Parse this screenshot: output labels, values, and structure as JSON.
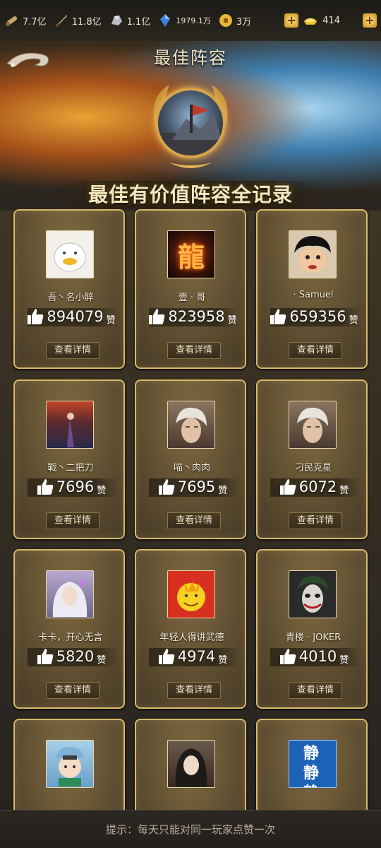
{
  "resources": [
    {
      "icon": "scroll-icon",
      "value": "7.7亿"
    },
    {
      "icon": "sword-icon",
      "value": "11.8亿"
    },
    {
      "icon": "ore-icon",
      "value": "1.1亿"
    },
    {
      "icon": "crystal-icon",
      "value": "1979.1万"
    },
    {
      "icon": "coin-icon",
      "value": "3万"
    }
  ],
  "gold_ingot": {
    "value": "414"
  },
  "banner": {
    "title": "最佳阵容",
    "subtitle": "最佳有价值阵容全记录"
  },
  "cards": [
    {
      "name": "吾丶名小醉",
      "likes": "894079",
      "unit": "赞",
      "button": "查看详情",
      "avatar_color": "#f2f0e8"
    },
    {
      "name": "壹 · 哥",
      "likes": "823958",
      "unit": "赞",
      "button": "查看详情",
      "avatar_color": "#1a0f0a"
    },
    {
      "name": "· Samuel",
      "likes": "659356",
      "unit": "赞",
      "button": "查看详情",
      "avatar_color": "#d8c9b0"
    },
    {
      "name": "戰丶二把刀",
      "likes": "7696",
      "unit": "赞",
      "button": "查看详情",
      "avatar_color": "#5a2a2e"
    },
    {
      "name": "喵丶肉肉",
      "likes": "7695",
      "unit": "赞",
      "button": "查看详情",
      "avatar_color": "#7a6450"
    },
    {
      "name": "刁民克星",
      "likes": "6072",
      "unit": "赞",
      "button": "查看详情",
      "avatar_color": "#7a6450"
    },
    {
      "name": "卡卡，开心无言",
      "likes": "5820",
      "unit": "赞",
      "button": "查看详情",
      "avatar_color": "#8a86a8"
    },
    {
      "name": "年轻人得讲武德",
      "likes": "4974",
      "unit": "赞",
      "button": "查看详情",
      "avatar_color": "#d83020"
    },
    {
      "name": "青楼 · JOKER",
      "likes": "4010",
      "unit": "赞",
      "button": "查看详情",
      "avatar_color": "#2a2a2a"
    },
    {
      "name": "",
      "likes": "",
      "unit": "",
      "button": "",
      "avatar_color": "#7fb0d8"
    },
    {
      "name": "",
      "likes": "",
      "unit": "",
      "button": "",
      "avatar_color": "#4a3a30"
    },
    {
      "name": "",
      "likes": "",
      "unit": "",
      "button": "",
      "avatar_color": "#1e62b8",
      "avatar_text": "静 静 静 静"
    }
  ],
  "footer": {
    "tip": "提示：每天只能对同一玩家点赞一次"
  }
}
